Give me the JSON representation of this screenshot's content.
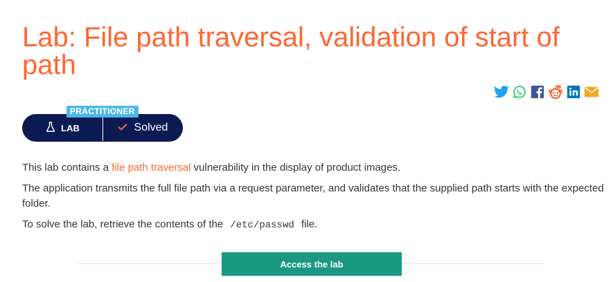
{
  "page": {
    "title": "Lab: File path traversal, validation of start of path"
  },
  "share": {
    "icons": [
      "twitter-icon",
      "whatsapp-icon",
      "facebook-icon",
      "reddit-icon",
      "linkedin-icon",
      "email-icon"
    ]
  },
  "lab_badge": {
    "level": "PRACTITIONER",
    "lab_label": "LAB",
    "status": "Solved"
  },
  "description": {
    "p1_before": "This lab contains a ",
    "p1_link": "file path traversal",
    "p1_after": " vulnerability in the display of product images.",
    "p2": "The application transmits the full file path via a request parameter, and validates that the supplied path starts with the expected folder.",
    "p3_before": "To solve the lab, retrieve the contents of the ",
    "p3_code": "/etc/passwd",
    "p3_after": " file."
  },
  "actions": {
    "access_label": "Access the lab"
  },
  "colors": {
    "title": "#ff6633",
    "link": "#ff6633",
    "pill": "#0b1a52",
    "level_tag": "#4db8ea",
    "button": "#1a9882",
    "check": "#ff6633"
  }
}
